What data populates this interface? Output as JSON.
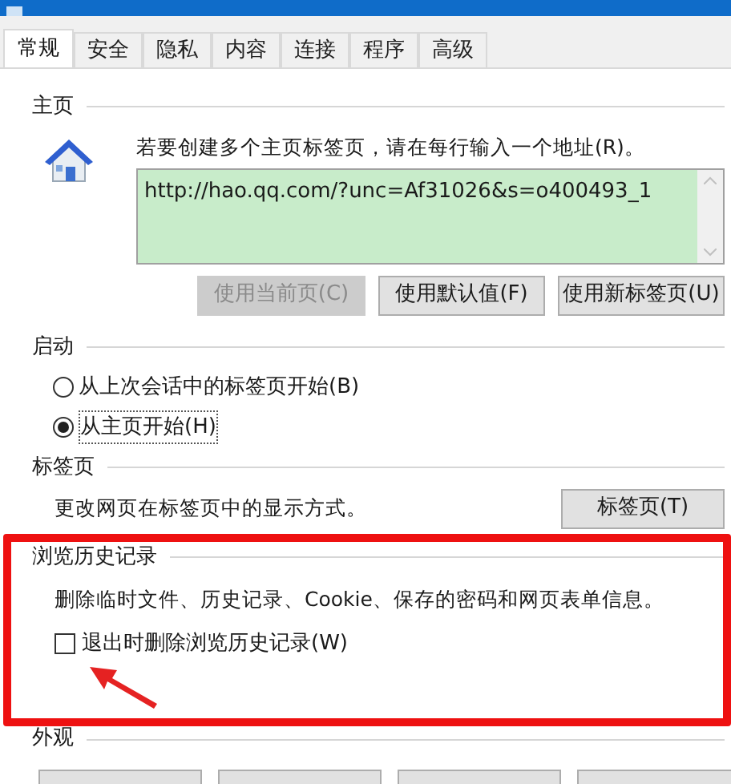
{
  "tabs": [
    {
      "label": "常规",
      "selected": true
    },
    {
      "label": "安全",
      "selected": false
    },
    {
      "label": "隐私",
      "selected": false
    },
    {
      "label": "内容",
      "selected": false
    },
    {
      "label": "连接",
      "selected": false
    },
    {
      "label": "程序",
      "selected": false
    },
    {
      "label": "高级",
      "selected": false
    }
  ],
  "home_page": {
    "heading": "主页",
    "instruction": "若要创建多个主页标签页，请在每行输入一个地址(R)。",
    "address": "http://hao.qq.com/?unc=Af31026&s=o400493_1",
    "buttons": [
      {
        "label": "使用当前页(C)",
        "disabled": true
      },
      {
        "label": "使用默认值(F)",
        "disabled": false
      },
      {
        "label": "使用新标签页(U)",
        "disabled": false
      }
    ]
  },
  "startup": {
    "heading": "启动",
    "options": [
      {
        "label": "从上次会话中的标签页开始(B)",
        "selected": false
      },
      {
        "label": "从主页开始(H)",
        "selected": true
      }
    ]
  },
  "tabs_section": {
    "heading": "标签页",
    "description": "更改网页在标签页中的显示方式。",
    "button": "标签页(T)"
  },
  "browsing_history": {
    "heading": "浏览历史记录",
    "description": "删除临时文件、历史记录、Cookie、保存的密码和网页表单信息。",
    "delete_on_exit": {
      "label": "退出时删除浏览历史记录(W)",
      "checked": false
    }
  },
  "appearance": {
    "heading": "外观"
  }
}
